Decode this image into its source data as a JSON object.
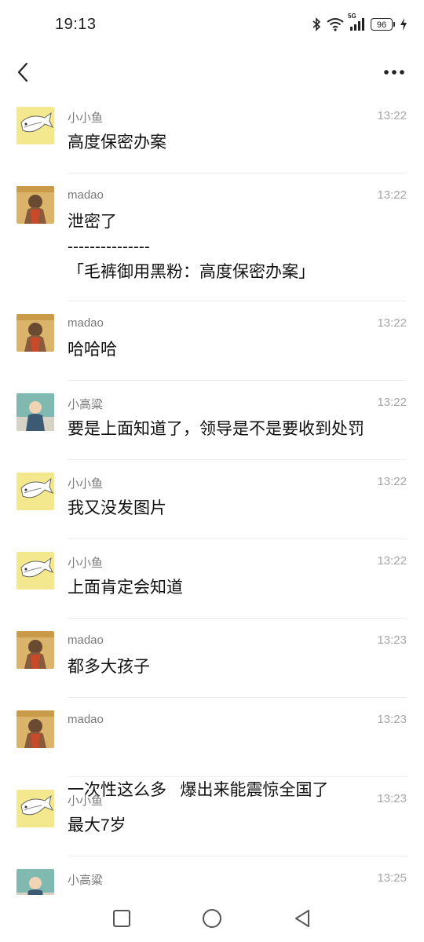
{
  "status_bar": {
    "time": "19:13",
    "network_label": "5G",
    "battery": "96"
  },
  "messages": [
    {
      "sender": "小小鱼",
      "time": "13:22",
      "avatar": "fish",
      "lines": [
        "高度保密办案"
      ]
    },
    {
      "sender": "madao",
      "time": "13:22",
      "avatar": "madao",
      "lines": [
        "泄密了",
        "---------------",
        "「毛裤御用黑粉：高度保密办案」"
      ]
    },
    {
      "sender": "madao",
      "time": "13:22",
      "avatar": "madao",
      "lines": [
        "哈哈哈"
      ]
    },
    {
      "sender": "小高粱",
      "time": "13:22",
      "avatar": "baby",
      "lines": [
        "要是上面知道了，领导是不是要收到处罚"
      ]
    },
    {
      "sender": "小小鱼",
      "time": "13:22",
      "avatar": "fish",
      "lines": [
        "我又没发图片"
      ]
    },
    {
      "sender": "小小鱼",
      "time": "13:22",
      "avatar": "fish",
      "lines": [
        "上面肯定会知道"
      ]
    },
    {
      "sender": "madao",
      "time": "13:23",
      "avatar": "madao",
      "lines": [
        "都多大孩子"
      ]
    },
    {
      "sender": "madao",
      "time": "13:23",
      "avatar": "madao",
      "lines": [
        "一次性这么多   爆出来能震惊全国了"
      ]
    },
    {
      "sender": "小小鱼",
      "time": "13:23",
      "avatar": "fish",
      "lines": [
        "最大7岁"
      ]
    },
    {
      "sender": "小高粱",
      "time": "13:25",
      "avatar": "baby",
      "lines": []
    }
  ],
  "icons": {
    "back": "chevron-left-icon",
    "more": "more-dots-icon",
    "recent_apps": "square-icon",
    "home": "circle-icon",
    "nav_back": "triangle-back-icon"
  },
  "colors": {
    "sender": "#7a7a7a",
    "time": "#a6a6a6",
    "divider": "#ececec",
    "text": "#111111"
  }
}
